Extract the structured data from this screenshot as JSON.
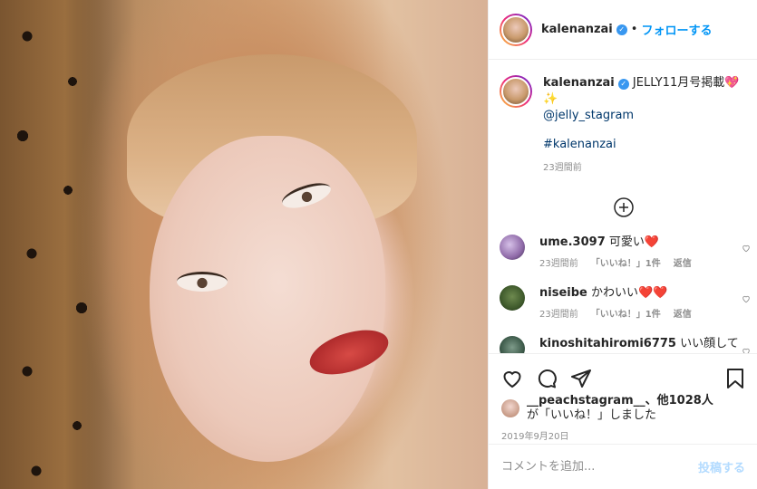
{
  "post": {
    "username": "kalenanzai",
    "follow_label": "フォローする",
    "dot": "•"
  },
  "caption": {
    "username": "kalenanzai",
    "text": "JELLY11月号掲載💖✨",
    "mention": "@jelly_stagram",
    "hashtag": "#kalenanzai",
    "time": "23週間前"
  },
  "comments": [
    {
      "username": "ume.3097",
      "text": "可愛い❤️",
      "time": "23週間前",
      "likes": "「いいね！」1件",
      "reply": "返信"
    },
    {
      "username": "niseibe",
      "text": "かわいい❤️❤️",
      "time": "23週間前",
      "likes": "「いいね！」1件",
      "reply": "返信"
    },
    {
      "username": "kinoshitahiromi6775",
      "text": "いい顔してる",
      "time": "",
      "likes": "",
      "reply": ""
    }
  ],
  "likes": {
    "line1": "__peachstagram__、他1028人",
    "line2": "が「いいね！」しました"
  },
  "date": "2019年9月20日",
  "add_comment": {
    "placeholder": "コメントを追加...",
    "post_label": "投稿する"
  },
  "colors": {
    "accent": "#0095f6",
    "verified": "#3897f0",
    "post_disabled": "#b3dbff",
    "meta": "#8e8e8e"
  }
}
